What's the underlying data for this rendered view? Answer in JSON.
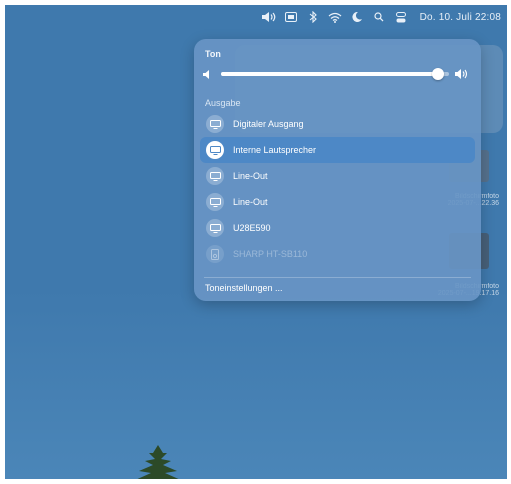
{
  "menubar": {
    "icons": [
      "volume-icon",
      "input-source-icon",
      "bluetooth-icon",
      "wifi-icon",
      "moon-icon",
      "search-icon",
      "control-center-icon"
    ],
    "clock": "Do. 10. Juli  22:08"
  },
  "sound_panel": {
    "title": "Ton",
    "volume_level": 0.95,
    "output_title": "Ausgabe",
    "devices": [
      {
        "label": "Digitaler Ausgang",
        "icon": "display-icon",
        "selected": false,
        "disabled": false
      },
      {
        "label": "Interne Lautsprecher",
        "icon": "display-icon",
        "selected": true,
        "disabled": false
      },
      {
        "label": "Line-Out",
        "icon": "display-icon",
        "selected": false,
        "disabled": false
      },
      {
        "label": "Line-Out",
        "icon": "display-icon",
        "selected": false,
        "disabled": false
      },
      {
        "label": "U28E590",
        "icon": "display-icon",
        "selected": false,
        "disabled": false
      },
      {
        "label": "SHARP HT-SB110",
        "icon": "speaker-icon",
        "selected": false,
        "disabled": true
      }
    ],
    "settings_link": "Toneinstellungen ..."
  },
  "desktop": {
    "items": [
      {
        "line1": "Bildschirmfoto",
        "line2": "2025-07-...22.36"
      },
      {
        "line1": "Bildschirmfoto",
        "line2": "2025-07-...19.17.16"
      }
    ]
  },
  "colors": {
    "desktop": "#3f79ad",
    "panel": "#6895c4",
    "selected_row": "#4d88c6"
  }
}
